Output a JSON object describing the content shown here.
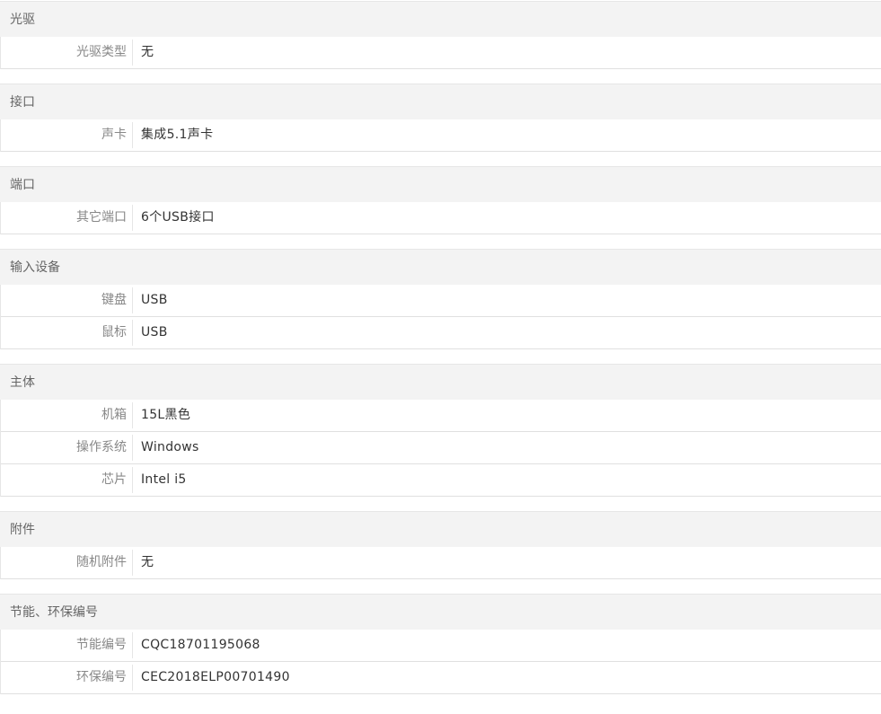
{
  "sections": [
    {
      "title": "光驱",
      "rows": [
        {
          "label": "光驱类型",
          "value": "无"
        }
      ]
    },
    {
      "title": "接口",
      "rows": [
        {
          "label": "声卡",
          "value": "集成5.1声卡"
        }
      ]
    },
    {
      "title": "端口",
      "rows": [
        {
          "label": "其它端口",
          "value": "6个USB接口"
        }
      ]
    },
    {
      "title": "输入设备",
      "rows": [
        {
          "label": "键盘",
          "value": "USB"
        },
        {
          "label": "鼠标",
          "value": "USB"
        }
      ]
    },
    {
      "title": "主体",
      "rows": [
        {
          "label": "机箱",
          "value": "15L黑色"
        },
        {
          "label": "操作系统",
          "value": "Windows"
        },
        {
          "label": "芯片",
          "value": "Intel i5"
        }
      ]
    },
    {
      "title": "附件",
      "rows": [
        {
          "label": "随机附件",
          "value": "无"
        }
      ]
    },
    {
      "title": "节能、环保编号",
      "rows": [
        {
          "label": "节能编号",
          "value": "CQC18701195068"
        },
        {
          "label": "环保编号",
          "value": "CEC2018ELP00701490"
        }
      ]
    }
  ]
}
